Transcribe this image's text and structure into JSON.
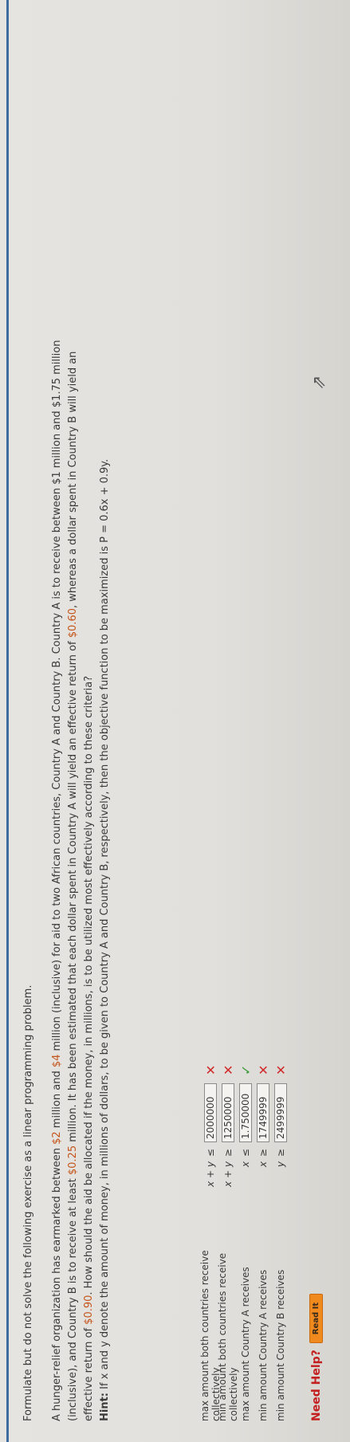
{
  "intro": "Formulate but do not solve the following exercise as a linear programming problem.",
  "problem": {
    "s1": "A hunger-relief organization has earmarked between",
    "m1": "$2",
    "s2": " million and ",
    "m2": "$4",
    "s3": " million (inclusive) for aid to two African countries, Country A and Country B. Country A is to receive between $1 million and",
    "m3": " $1.75 ",
    "s4": "million (inclusive), and Country B is to receive at least ",
    "m4": "$0.25",
    "s5": " million. It has been estimated that each dollar spent in Country A will yield an effective return of ",
    "m5": "$0.60",
    "s6": ", whereas a dollar spent in Country B will yield an effective return of ",
    "m6": "$0.90",
    "s7": ". How should the aid be allocated if the money, in millions, is to be utilized most effectively according to these criteria?"
  },
  "hint": {
    "label": "Hint:",
    "text": " If x and y denote the amount of money, in millions of dollars, to be given to Country A and Country B, respectively, then the objective function to be maximized is P = 0.6x + 0.9y."
  },
  "rows": [
    {
      "label": "max amount both countries receive collectively",
      "lhs": "x + y",
      "op": "≤",
      "value": "2000000",
      "mark": "✕"
    },
    {
      "label": "min amount both countries receive collectively",
      "lhs": "x + y",
      "op": "≥",
      "value": "1250000",
      "mark": "✕"
    },
    {
      "label": "max amount Country A receives",
      "lhs": "x",
      "op": "≤",
      "value": "1.750000",
      "mark": "✓"
    },
    {
      "label": "min amount Country A receives",
      "lhs": "x",
      "op": "≥",
      "value": "1749999",
      "mark": "✕"
    },
    {
      "label": "min amount Country B receives",
      "lhs": "y",
      "op": "≥",
      "value": "2499999",
      "mark": "✕"
    }
  ],
  "help": {
    "label": "Need Help?",
    "button": "Read It"
  }
}
